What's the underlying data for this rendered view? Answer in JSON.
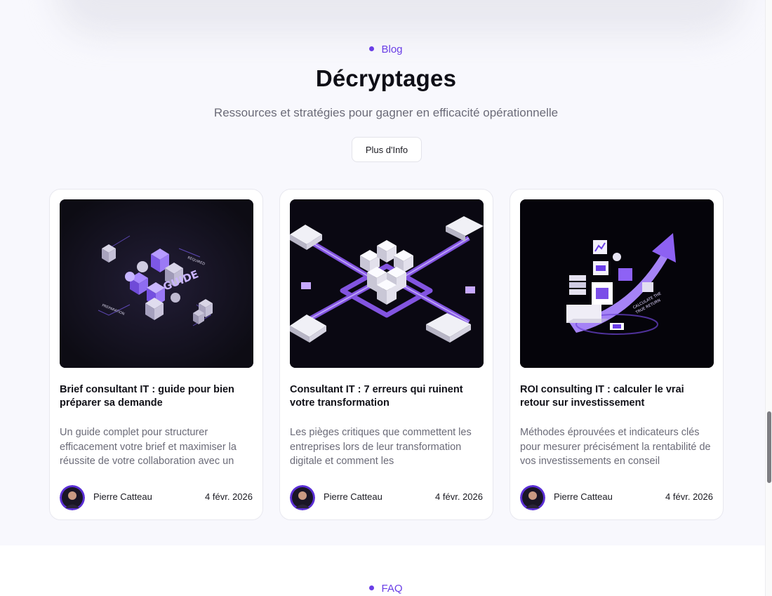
{
  "blog": {
    "eyebrow": "Blog",
    "title": "Décryptages",
    "subtitle": "Ressources et stratégies pour gagner en efficacité opérationnelle",
    "more_button": "Plus d'Info",
    "cards": [
      {
        "title": "Brief consultant IT : guide pour bien préparer sa demande",
        "excerpt": "Un guide complet pour structurer efficacement votre brief et maximiser la réussite de votre collaboration avec un",
        "author": "Pierre Catteau",
        "date": "4 févr. 2026",
        "image_labels": [
          "GUIDE",
          "REQUIRED",
          "PREPARATION"
        ]
      },
      {
        "title": "Consultant IT : 7 erreurs qui ruinent votre transformation",
        "excerpt": "Les pièges critiques que commettent les entreprises lors de leur transformation digitale et comment les",
        "author": "Pierre Catteau",
        "date": "4 févr. 2026"
      },
      {
        "title": "ROI consulting IT : calculer le vrai retour sur investissement",
        "excerpt": "Méthodes éprouvées et indicateurs clés pour mesurer précisément la rentabilité de vos investissements en conseil",
        "author": "Pierre Catteau",
        "date": "4 févr. 2026",
        "image_labels": [
          "CALCULATE THE",
          "TRUE RETURN"
        ]
      }
    ]
  },
  "faq": {
    "eyebrow": "FAQ"
  },
  "colors": {
    "accent": "#6a3ee6",
    "section_bg": "#f8f8fd",
    "text_muted": "#6b6b78"
  }
}
